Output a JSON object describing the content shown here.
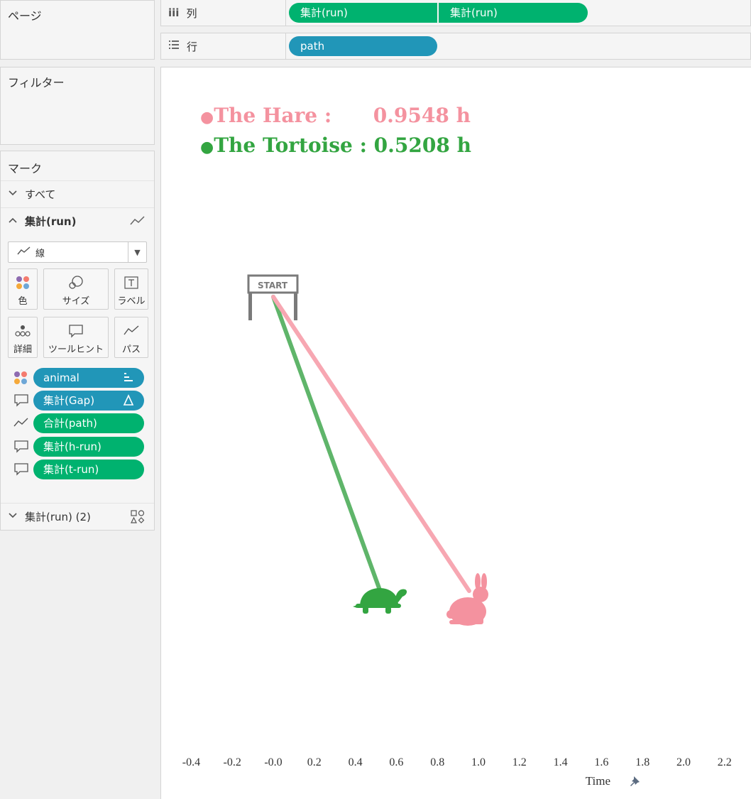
{
  "panels": {
    "pages_title": "ページ",
    "filters_title": "フィルター",
    "marks_title": "マーク"
  },
  "columns_shelf": {
    "label": "列",
    "pills": [
      "集計(run)",
      "集計(run)"
    ]
  },
  "rows_shelf": {
    "label": "行",
    "pills": [
      "path"
    ]
  },
  "marks": {
    "all_label": "すべて",
    "card1_label": "集計(run)",
    "mark_type": "線",
    "buttons": {
      "color": "色",
      "size": "サイズ",
      "label": "ラベル",
      "detail": "詳細",
      "tooltip": "ツールヒント",
      "path": "パス"
    },
    "fields": [
      {
        "name": "animal",
        "kind": "color",
        "pill_color": "blue"
      },
      {
        "name": "集計(Gap)",
        "kind": "tooltip",
        "pill_color": "blue"
      },
      {
        "name": "合計(path)",
        "kind": "path",
        "pill_color": "green"
      },
      {
        "name": "集計(h-run)",
        "kind": "tooltip",
        "pill_color": "green"
      },
      {
        "name": "集計(t-run)",
        "kind": "tooltip",
        "pill_color": "green"
      }
    ],
    "card2_label": "集計(run) (2)"
  },
  "viz": {
    "legend": [
      {
        "bullet": "●",
        "text": "The Hare :      0.9548 h",
        "color": "#f4929f"
      },
      {
        "bullet": "●",
        "text": "The Tortoise : 0.5208 h",
        "color": "#33a541"
      }
    ],
    "start_sign": "START",
    "axis_title": "Time",
    "pin_icon": "pin-icon"
  },
  "chart_data": {
    "type": "line",
    "xlabel": "Time",
    "xlim": [
      -0.45,
      2.3
    ],
    "x_ticks": [
      "-0.4",
      "-0.2",
      "-0.0",
      "0.2",
      "0.4",
      "0.6",
      "0.8",
      "1.0",
      "1.2",
      "1.4",
      "1.6",
      "1.8",
      "2.0",
      "2.2"
    ],
    "series": [
      {
        "name": "The Tortoise",
        "color": "#5fb56a",
        "x": [
          0.0,
          0.5208
        ],
        "path": [
          0,
          1
        ]
      },
      {
        "name": "The Hare",
        "color": "#f7a7b2",
        "x": [
          0.0,
          0.9548
        ],
        "path": [
          0,
          1
        ]
      }
    ]
  }
}
